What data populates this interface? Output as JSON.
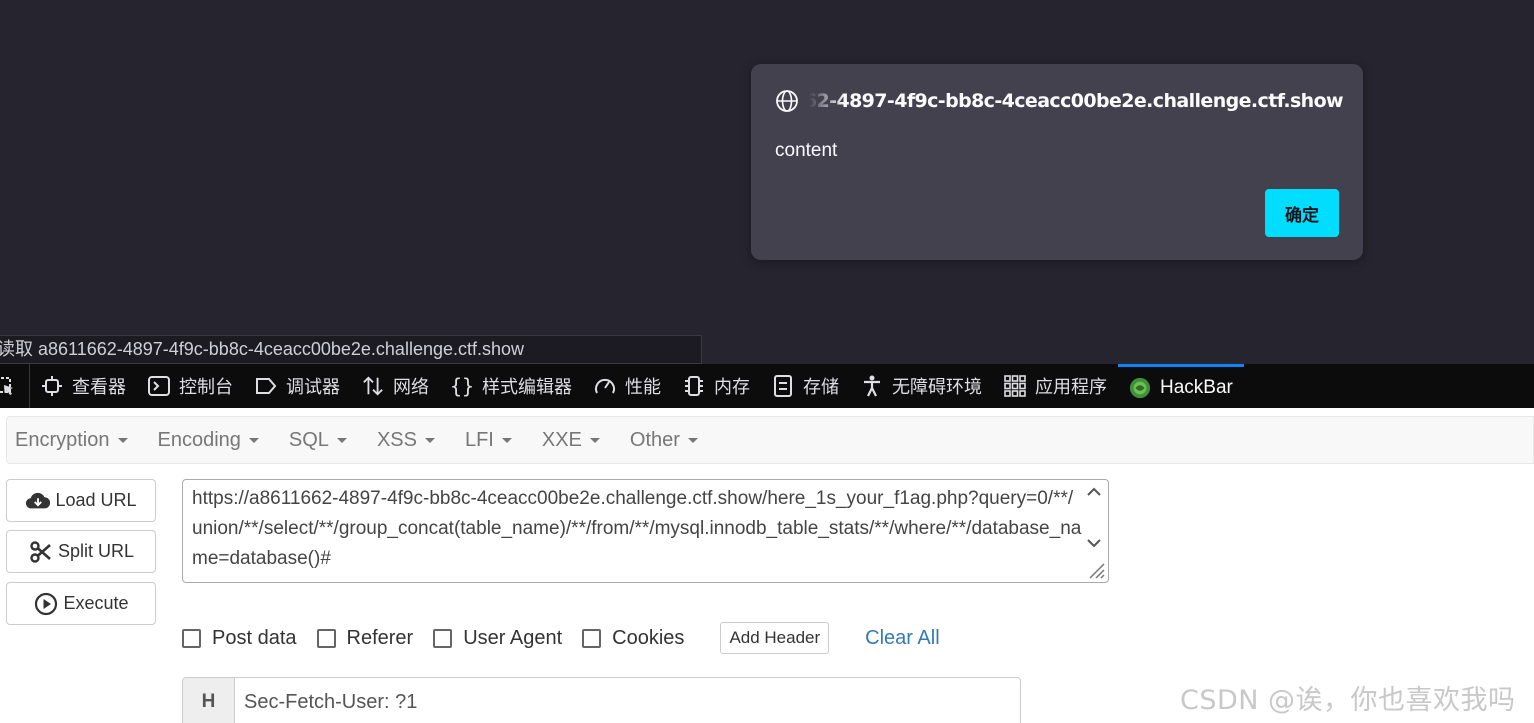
{
  "alert": {
    "origin": "a8611662-4897-4f9c-bb8c-4ceacc00be2e.challenge.ctf.show",
    "message": "content",
    "ok_label": "确定"
  },
  "status_bar": {
    "text": "读取 a8611662-4897-4f9c-bb8c-4ceacc00be2e.challenge.ctf.show"
  },
  "devtools": {
    "tabs": [
      {
        "label": "查看器",
        "icon": "inspector-icon"
      },
      {
        "label": "控制台",
        "icon": "console-icon"
      },
      {
        "label": "调试器",
        "icon": "debugger-icon"
      },
      {
        "label": "网络",
        "icon": "network-icon"
      },
      {
        "label": "样式编辑器",
        "icon": "style-editor-icon"
      },
      {
        "label": "性能",
        "icon": "performance-icon"
      },
      {
        "label": "内存",
        "icon": "memory-icon"
      },
      {
        "label": "存储",
        "icon": "storage-icon"
      },
      {
        "label": "无障碍环境",
        "icon": "accessibility-icon"
      },
      {
        "label": "应用程序",
        "icon": "application-icon"
      },
      {
        "label": "HackBar",
        "icon": "hackbar-icon"
      }
    ],
    "active_tab": "HackBar",
    "accent_color": "#0a84ff"
  },
  "hackbar": {
    "menu": [
      "Encryption",
      "Encoding",
      "SQL",
      "XSS",
      "LFI",
      "XXE",
      "Other"
    ],
    "buttons": {
      "load": "Load URL",
      "split": "Split URL",
      "execute": "Execute"
    },
    "url": "https://a8611662-4897-4f9c-bb8c-4ceacc00be2e.challenge.ctf.show/here_1s_your_f1ag.php?query=0/**/union/**/select/**/group_concat(table_name)/**/from/**/mysql.innodb_table_stats/**/where/**/database_name=database()#",
    "options": {
      "post_data": "Post data",
      "referer": "Referer",
      "user_agent": "User Agent",
      "cookies": "Cookies",
      "add_header": "Add Header",
      "clear_all": "Clear All"
    },
    "header": {
      "tag": "H",
      "value": "Sec-Fetch-User: ?1"
    }
  },
  "watermark": "CSDN @诶，你也喜欢我吗"
}
